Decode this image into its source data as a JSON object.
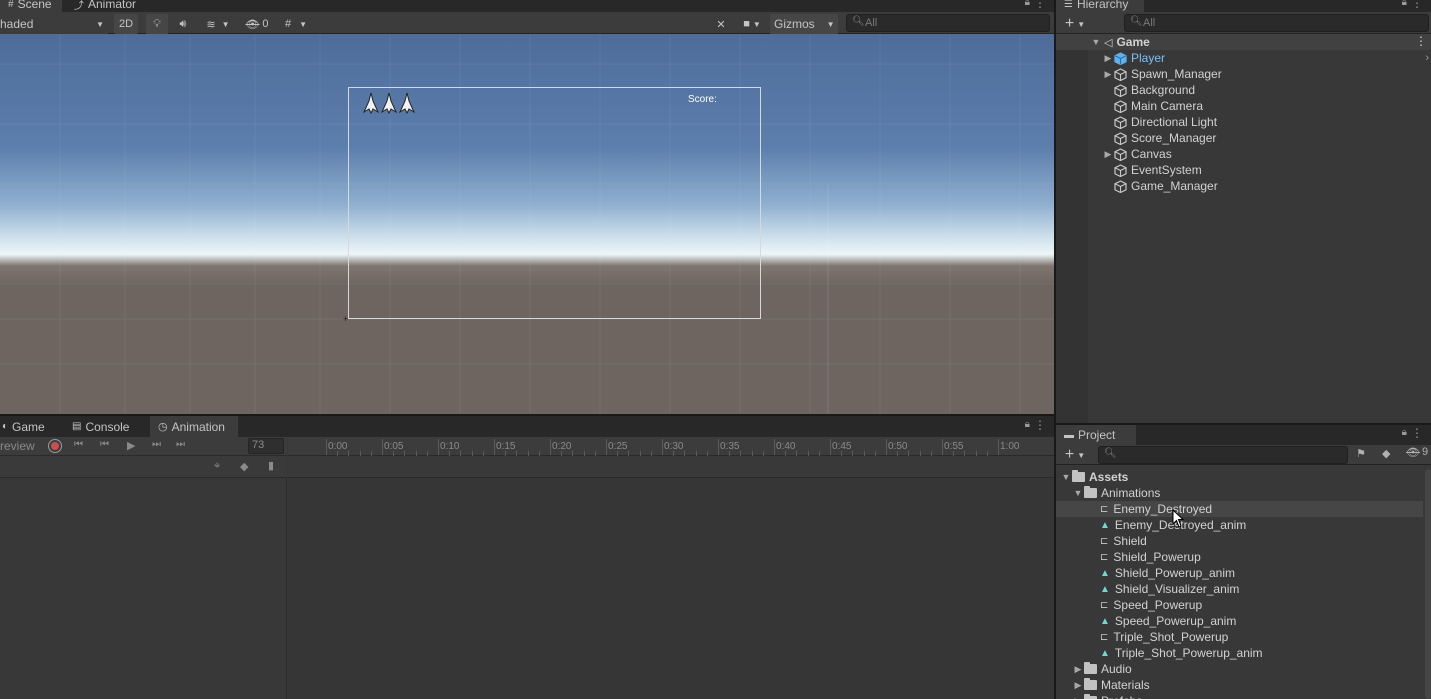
{
  "scene": {
    "tabs": [
      {
        "label": "Scene",
        "icon": "scene-grid-icon"
      },
      {
        "label": "Animator",
        "icon": "animator-icon"
      }
    ],
    "toolbar": {
      "shading_mode": "haded",
      "btn_2d": "2D",
      "hidden_count": "0",
      "gizmos_label": "Gizmos",
      "search_placeholder": "All"
    },
    "canvas": {
      "score_label": "Score:"
    },
    "colors": {
      "sky_top": "#4f6f9e",
      "horizon": "#e8f1f6",
      "ground": "#6e6560"
    }
  },
  "hierarchy": {
    "tab_label": "Hierarchy",
    "search_placeholder": "All",
    "scene_name": "Game",
    "items": [
      {
        "label": "Player",
        "foldout": true,
        "selected_color": true
      },
      {
        "label": "Spawn_Manager",
        "foldout": true
      },
      {
        "label": "Background",
        "foldout": false
      },
      {
        "label": "Main Camera",
        "foldout": false
      },
      {
        "label": "Directional Light",
        "foldout": false
      },
      {
        "label": "Score_Manager",
        "foldout": false
      },
      {
        "label": "Canvas",
        "foldout": true
      },
      {
        "label": "EventSystem",
        "foldout": false
      },
      {
        "label": "Game_Manager",
        "foldout": false
      }
    ]
  },
  "bottom": {
    "tabs": [
      {
        "label": "Game",
        "icon": "game-icon"
      },
      {
        "label": "Console",
        "icon": "console-icon"
      },
      {
        "label": "Animation",
        "icon": "animation-clock-icon"
      }
    ],
    "animation": {
      "preview_label": "review",
      "frame_value": "73",
      "timeline_ticks": [
        "0:00",
        "0:05",
        "0:10",
        "0:15",
        "0:20",
        "0:25",
        "0:30",
        "0:35",
        "0:40",
        "0:45",
        "0:50",
        "0:55",
        "1:00"
      ]
    }
  },
  "project": {
    "tab_label": "Project",
    "hidden_count": "9",
    "root": "Assets",
    "animations_folder": "Animations",
    "files": [
      {
        "label": "Enemy_Destroyed",
        "kind": "controller"
      },
      {
        "label": "Enemy_Destroyed_anim",
        "kind": "clip"
      },
      {
        "label": "Shield",
        "kind": "controller"
      },
      {
        "label": "Shield_Powerup",
        "kind": "controller"
      },
      {
        "label": "Shield_Powerup_anim",
        "kind": "clip"
      },
      {
        "label": "Shield_Visualizer_anim",
        "kind": "clip"
      },
      {
        "label": "Speed_Powerup",
        "kind": "controller"
      },
      {
        "label": "Speed_Powerup_anim",
        "kind": "clip"
      },
      {
        "label": "Triple_Shot_Powerup",
        "kind": "controller"
      },
      {
        "label": "Triple_Shot_Powerup_anim",
        "kind": "clip"
      }
    ],
    "other_folders": [
      "Audio",
      "Materials",
      "Prefabs"
    ]
  }
}
